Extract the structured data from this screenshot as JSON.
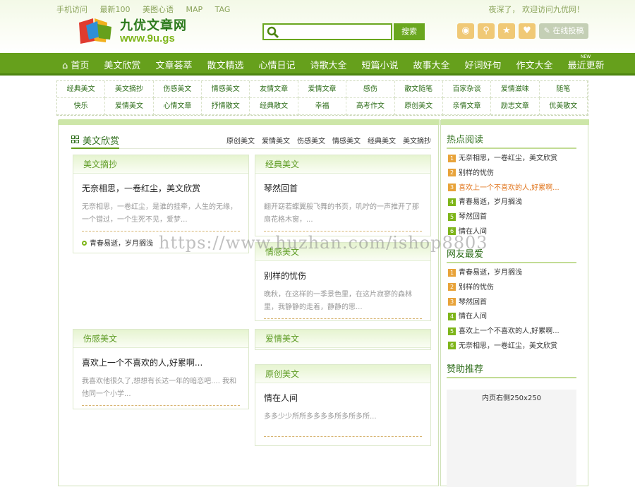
{
  "header": {
    "top_links": [
      "手机访问",
      "最新100",
      "美图心语",
      "MAP",
      "TAG"
    ],
    "welcome": "夜深了， 欢迎访问九优网！",
    "logo_name": "九优文章网",
    "logo_url": "www.9u.gs",
    "search_placeholder": "",
    "search_button": "搜索",
    "post_button": "在线投稿"
  },
  "nav": {
    "items": [
      "首页",
      "美文欣赏",
      "文章荟萃",
      "散文精选",
      "心情日记",
      "诗歌大全",
      "短篇小说",
      "故事大全",
      "好词好句",
      "作文大全",
      "最近更新"
    ],
    "badge": "NEW"
  },
  "subnav": {
    "row1": [
      "经典美文",
      "美文摘抄",
      "伤感美文",
      "情感美文",
      "友情文章",
      "爱情文章",
      "感伤",
      "散文随笔",
      "百家杂谈",
      "爱情滋味",
      "随笔"
    ],
    "row2": [
      "快乐",
      "爱情美文",
      "心情文章",
      "抒情散文",
      "经典散文",
      "幸福",
      "高考作文",
      "原创美文",
      "亲情文章",
      "励志文章",
      "优美散文"
    ]
  },
  "section": {
    "title": "美文欣赏",
    "tabs": [
      "原创美文",
      "爱情美文",
      "伤感美文",
      "情感美文",
      "经典美文",
      "美文摘抄"
    ]
  },
  "cards": {
    "c1": {
      "head": "美文摘抄",
      "title": "无奈相思，一卷红尘，美文欣赏",
      "text": "无奈相思，一卷红尘，是谁的挂牵，人生的无缘，一个错过，一个生死不见，爱梦...",
      "foot": "青春易逝，岁月搁浅"
    },
    "c2": {
      "head": "经典美文",
      "title": "琴然回首",
      "text": "翻开窈若蝶翼般飞舞的书页，叽咛的一声推开了那扇花格木窗，..."
    },
    "c3": {
      "head": "情感美文",
      "title": "别样的忧伤",
      "text": "晚秋，在这样的一季景色里，在这片寂寥的森林里，我静静的走着，静静的思..."
    },
    "c4": {
      "head": "伤感美文",
      "title": "喜欢上一个不喜欢的人,好累啊...",
      "text": "我喜欢他很久了,想想有长达一年的暗恋吧.... 我和他同一个小学..."
    },
    "c5": {
      "head": "爱情美文"
    },
    "c6": {
      "head": "原创美文",
      "title": "情在人间",
      "text": "多多少少所所多多多多所多所多所..."
    }
  },
  "sidebar": {
    "hot_title": "热点阅读",
    "hot": [
      "无奈相思，一卷红尘，美文欣赏",
      "别样的忧伤",
      "喜欢上一个不喜欢的人,好累啊...",
      "青春易逝，岁月搁浅",
      "琴然回首",
      "情在人间"
    ],
    "fav_title": "网友最爱",
    "fav": [
      "青春易逝，岁月搁浅",
      "别样的忧伤",
      "琴然回首",
      "情在人间",
      "喜欢上一个不喜欢的人,好累啊...",
      "无奈相思，一卷红尘，美文欣赏"
    ],
    "ad_title": "赞助推荐",
    "ad_text": "内页右侧250x250"
  },
  "watermark": "https://www.huzhan.com/ishop8803"
}
